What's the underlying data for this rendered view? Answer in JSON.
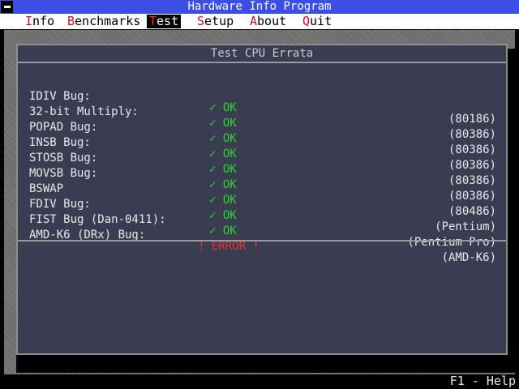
{
  "title_bar": {
    "title": "Hardware Info Program"
  },
  "menu": [
    {
      "hotkey": "I",
      "rest": "nfo",
      "active": false
    },
    {
      "hotkey": "B",
      "rest": "enchmarks",
      "active": false
    },
    {
      "hotkey": "T",
      "rest": "est",
      "active": true
    },
    {
      "hotkey": "S",
      "rest": "etup",
      "active": false
    },
    {
      "hotkey": "A",
      "rest": "bout",
      "active": false
    },
    {
      "hotkey": "Q",
      "rest": "uit",
      "active": false
    }
  ],
  "window": {
    "title": "Test CPU Errata",
    "rows": [
      {
        "name": "IDIV Bug:",
        "status": "✓ OK",
        "cpu": "(80186)",
        "ok": true
      },
      {
        "name": "32-bit Multiply:",
        "status": "✓ OK",
        "cpu": "(80386)",
        "ok": true
      },
      {
        "name": "POPAD Bug:",
        "status": "✓ OK",
        "cpu": "(80386)",
        "ok": true
      },
      {
        "name": "INSB Bug:",
        "status": "✓ OK",
        "cpu": "(80386)",
        "ok": true
      },
      {
        "name": "STOSB Bug:",
        "status": "✓ OK",
        "cpu": "(80386)",
        "ok": true
      },
      {
        "name": "MOVSB Bug:",
        "status": "✓ OK",
        "cpu": "(80386)",
        "ok": true
      },
      {
        "name": "BSWAP",
        "status": "✓ OK",
        "cpu": "(80486)",
        "ok": true
      },
      {
        "name": "FDIV Bug:",
        "status": "✓ OK",
        "cpu": "(Pentium)",
        "ok": true
      },
      {
        "name": "FIST Bug (Dan-0411):",
        "status": "✓ OK",
        "cpu": "(Pentium Pro)",
        "ok": true
      },
      {
        "name": "AMD-K6 (DRx) Bug:",
        "status": "! ERROR !",
        "cpu": "(AMD-K6)",
        "ok": false
      }
    ]
  },
  "status_bar": {
    "help": "F1 - Help"
  },
  "colors": {
    "title_bg": "#3c4ee6",
    "ok": "#2ed42e",
    "error": "#e0342e",
    "hotkey": "#c8102e",
    "window_bg": "#3a3d52"
  },
  "icons": {
    "system_menu": "system-menu-icon"
  }
}
